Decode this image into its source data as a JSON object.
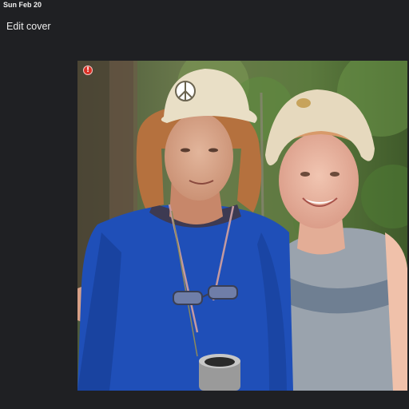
{
  "status_bar": {
    "date": "Sun Feb 20"
  },
  "header": {
    "title": "Edit cover"
  },
  "cover": {
    "error_icon": "error-icon",
    "error_glyph": "!",
    "colors": {
      "background": "#1f2023",
      "error": "#d93025"
    }
  }
}
